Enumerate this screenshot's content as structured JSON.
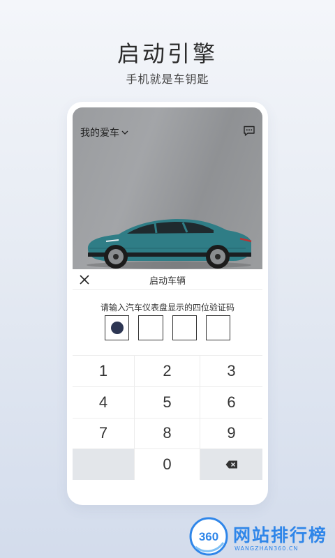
{
  "promo": {
    "headline": "启动引擎",
    "subheadline": "手机就是车钥匙"
  },
  "app": {
    "header_title": "我的爱车",
    "header_dropdown_icon": "chevron-down-icon",
    "message_icon": "chat-bubble-icon",
    "car_color": "#2f7d86"
  },
  "sheet": {
    "close_icon": "close-icon",
    "title": "启动车辆",
    "instruction": "请输入汽车仪表盘显示的四位验证码",
    "code_slots": [
      {
        "filled": true
      },
      {
        "filled": false
      },
      {
        "filled": false
      },
      {
        "filled": false
      }
    ]
  },
  "keypad": {
    "keys": [
      "1",
      "2",
      "3",
      "4",
      "5",
      "6",
      "7",
      "8",
      "9",
      "",
      "0",
      ""
    ],
    "backspace_icon": "backspace-icon"
  },
  "colors": {
    "accent": "#2d3653",
    "watermark_blue": "#2f86e9"
  },
  "watermark": {
    "logo_text": "360",
    "site_name": "网站排行榜",
    "url": "WANGZHAN360.CN"
  }
}
